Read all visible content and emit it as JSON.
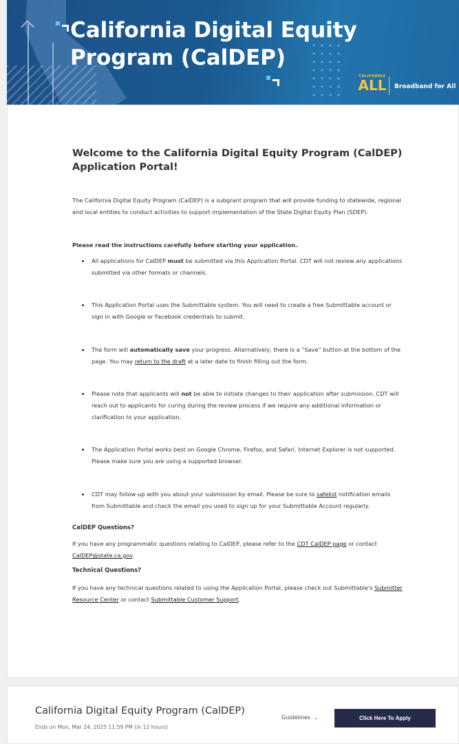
{
  "banner": {
    "title": "California Digital Equity Program (CalDEP)",
    "ca_small": "CALIFORNIA",
    "ca_big": "ALL",
    "tagline": "Broadband for All",
    "colors": {
      "gradient_start": "#1d4f87",
      "gradient_end": "#2475ad",
      "accent": "#f5c542"
    }
  },
  "main": {
    "heading": "Welcome to the California Digital Equity Program (CalDEP) Application Portal!",
    "intro": "The California Digital Equity Program (CalDEP) is a subgrant program that will provide funding to statewide, regional and local entities to conduct activities to support implementation of the State Digital Equity Plan (SDEP).",
    "instructions_lead": "Please read the instructions carefully before starting your application.",
    "items": [
      {
        "pre": "All applications for CalDEP ",
        "strong": "must",
        "post": " be submitted via this Application Portal. CDT will not review any applications submitted via other formats or channels."
      },
      {
        "text": "This Application Portal uses the Submittable system. You will need to create a free Submittable account or sign in with Google or Facebook credentials to submit."
      },
      {
        "pre": "The form will ",
        "strong": "automatically save",
        "mid": " your progress. Alternatively, there is a “Save” button at the bottom of the page. You may ",
        "link": "return to the draft",
        "post": " at a later date to finish filling out the form."
      },
      {
        "pre": "Please note that applicants will ",
        "strong": "not",
        "post": " be able to initiate changes to their application after submission. CDT will reach out to applicants for curing during the review process if we require any additional information or clarification to your application."
      },
      {
        "text": "The Application Portal works best on Google Chrome, Firefox, and Safari. Internet Explorer is not supported. Please make sure you are using a supported browser."
      },
      {
        "pre": "CDT may follow-up with you about your submission by email. Please be sure to ",
        "link": "safelist",
        "post": " notification emails from Submittable and check the email you used to sign up for your Submittable Account regularly."
      }
    ],
    "caldep_q_heading": "CalDEP Questions?",
    "caldep_q_pre": "If you have any programmatic questions relating to CalDEP, please refer to the ",
    "caldep_q_link": "CDT CalDEP page",
    "caldep_q_mid": " or contact ",
    "caldep_q_email": "CalDEP@state.ca.gov",
    "caldep_q_post": ".",
    "tech_q_heading": "Technical Questions?",
    "tech_q_pre": "If you have any technical questions related to using the Application Portal, please check out Submittable's ",
    "tech_q_link1": "Submitter Resource Center",
    "tech_q_mid": " or contact ",
    "tech_q_link2": "Submittable Customer Support",
    "tech_q_post": "."
  },
  "footer_card": {
    "program_title": "California Digital Equity Program (CalDEP)",
    "deadline": "Ends on Mon, Mar 24, 2025 11:59 PM (in 12 hours)",
    "guidelines_label": "Guidelines",
    "guidelines_icon": "chevron-down-icon",
    "apply_label": "Click Here To Apply",
    "apply_color": "#262a4a"
  }
}
